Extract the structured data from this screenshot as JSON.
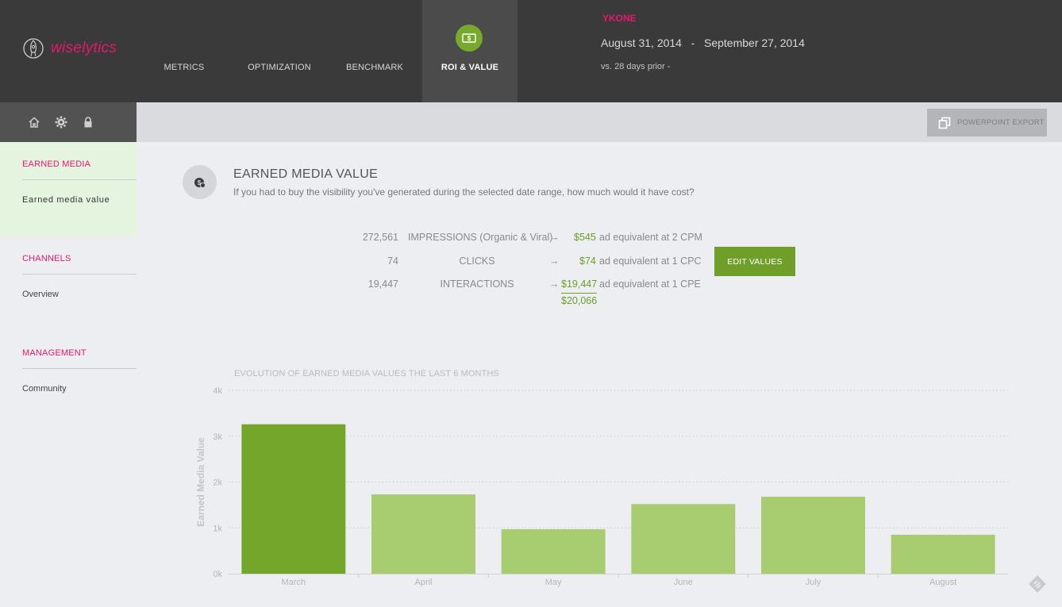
{
  "brand": {
    "name": "wiselytics",
    "color": "#e5176f"
  },
  "nav": {
    "items": [
      {
        "label": "METRICS",
        "active": false
      },
      {
        "label": "OPTIMIZATION",
        "active": false
      },
      {
        "label": "BENCHMARK",
        "active": false
      },
      {
        "label": "ROI & VALUE",
        "active": true,
        "icon": "dollar-bill-icon"
      }
    ]
  },
  "header": {
    "client": "YKONE",
    "date_start": "August 31, 2014",
    "date_sep": "-",
    "date_end": "September 27, 2014",
    "compare": "vs. 28 days prior  -"
  },
  "iconbar": {
    "icons": [
      "home-icon",
      "gear-icon",
      "lock-icon"
    ]
  },
  "toolbar": {
    "export_label": "POWERPOINT EXPORT",
    "export_icon": "copy-icon"
  },
  "sidebar": {
    "sections": [
      {
        "title": "EARNED MEDIA",
        "links": [
          "Earned media value"
        ],
        "active": true
      },
      {
        "title": "CHANNELS",
        "links": [
          "Overview"
        ],
        "active": false
      },
      {
        "title": "MANAGEMENT",
        "links": [
          "Community"
        ],
        "active": false
      }
    ]
  },
  "main": {
    "icon": "money-bag-icon",
    "title": "EARNED MEDIA VALUE",
    "subtitle": "If you had to buy the visibility you've generated during the selected date range, how much would it have cost?",
    "rows": [
      {
        "count": "272,561",
        "metric": "IMPRESSIONS (Organic & Viral)",
        "arrow": "→",
        "value": "$545",
        "equiv": "ad equivalent at 2 CPM"
      },
      {
        "count": "74",
        "metric": "CLICKS",
        "arrow": "→",
        "value": "$74",
        "equiv": "ad equivalent at 1 CPC"
      },
      {
        "count": "19,447",
        "metric": "INTERACTIONS",
        "arrow": "→",
        "value": "$19,447",
        "equiv": "ad equivalent at 1 CPE"
      }
    ],
    "total": "$20,066",
    "edit_label": "EDIT VALUES",
    "accent": "#6f9f28"
  },
  "chart_data": {
    "type": "bar",
    "title": "EVOLUTION OF EARNED MEDIA VALUES THE LAST 6 MONTHS",
    "ylabel": "Earned Media Value",
    "xlabel": "",
    "categories": [
      "March",
      "April",
      "May",
      "June",
      "July",
      "August"
    ],
    "values": [
      3260,
      1730,
      970,
      1520,
      1680,
      850
    ],
    "ylim": [
      0,
      4000
    ],
    "yticks": [
      "0k",
      "1k",
      "2k",
      "3k",
      "4k"
    ],
    "highlight_index": 0,
    "colors": {
      "highlight": "#74a62c",
      "bar": "#a8cc70",
      "grid": "#c9cbce"
    },
    "grid": true
  }
}
